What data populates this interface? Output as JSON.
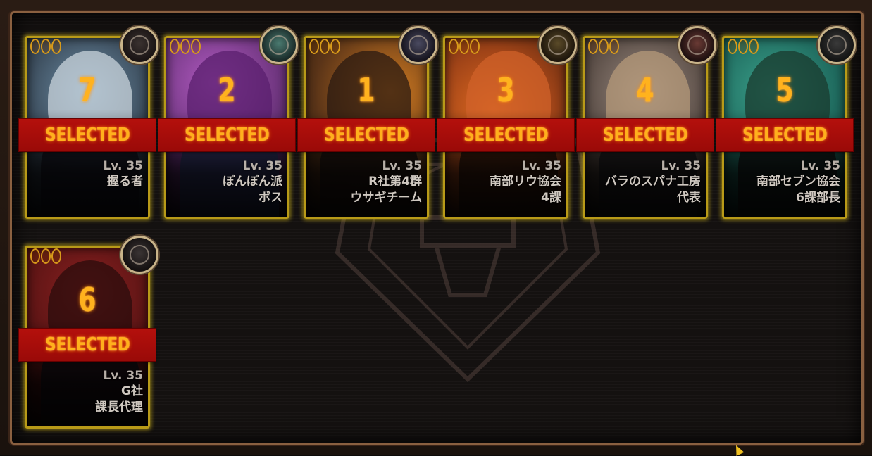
{
  "cards": [
    {
      "order": "7",
      "selected_label": "SELECTED",
      "level": "Lv. 35",
      "line1": "",
      "line2": "握る者",
      "art_color": "#6d8fa8",
      "hair_color": "#c9d4dc"
    },
    {
      "order": "2",
      "selected_label": "SELECTED",
      "level": "Lv. 35",
      "line1": "ぽんぽん派",
      "line2": "ボス",
      "art_color": "#8a3a9c",
      "hair_color": "#5a1f6e"
    },
    {
      "order": "1",
      "selected_label": "SELECTED",
      "level": "Lv. 35",
      "line1": "R社第4群",
      "line2": "ウサギチーム",
      "art_color": "#5a3418",
      "hair_color": "#2a1a12"
    },
    {
      "order": "3",
      "selected_label": "SELECTED",
      "level": "Lv. 35",
      "line1": "南部リウ協会",
      "line2": "4課",
      "art_color": "#a04418",
      "hair_color": "#d0622a"
    },
    {
      "order": "4",
      "selected_label": "SELECTED",
      "level": "Lv. 35",
      "line1": "バラのスパナ工房",
      "line2": "代表",
      "art_color": "#6a5a52",
      "hair_color": "#b59a7a"
    },
    {
      "order": "5",
      "selected_label": "SELECTED",
      "level": "Lv. 35",
      "line1": "南部セブン協会",
      "line2": "6課部長",
      "art_color": "#1f6a5e",
      "hair_color": "#1a3a2e"
    },
    {
      "order": "6",
      "selected_label": "SELECTED",
      "level": "Lv. 35",
      "line1": "G社",
      "line2": "課長代理",
      "art_color": "#5a1414",
      "hair_color": "#2a0c0c"
    }
  ],
  "colors": {
    "accent_gold": "#b89a18",
    "selected_red": "#b4100c",
    "number_orange": "#ffb21e"
  }
}
